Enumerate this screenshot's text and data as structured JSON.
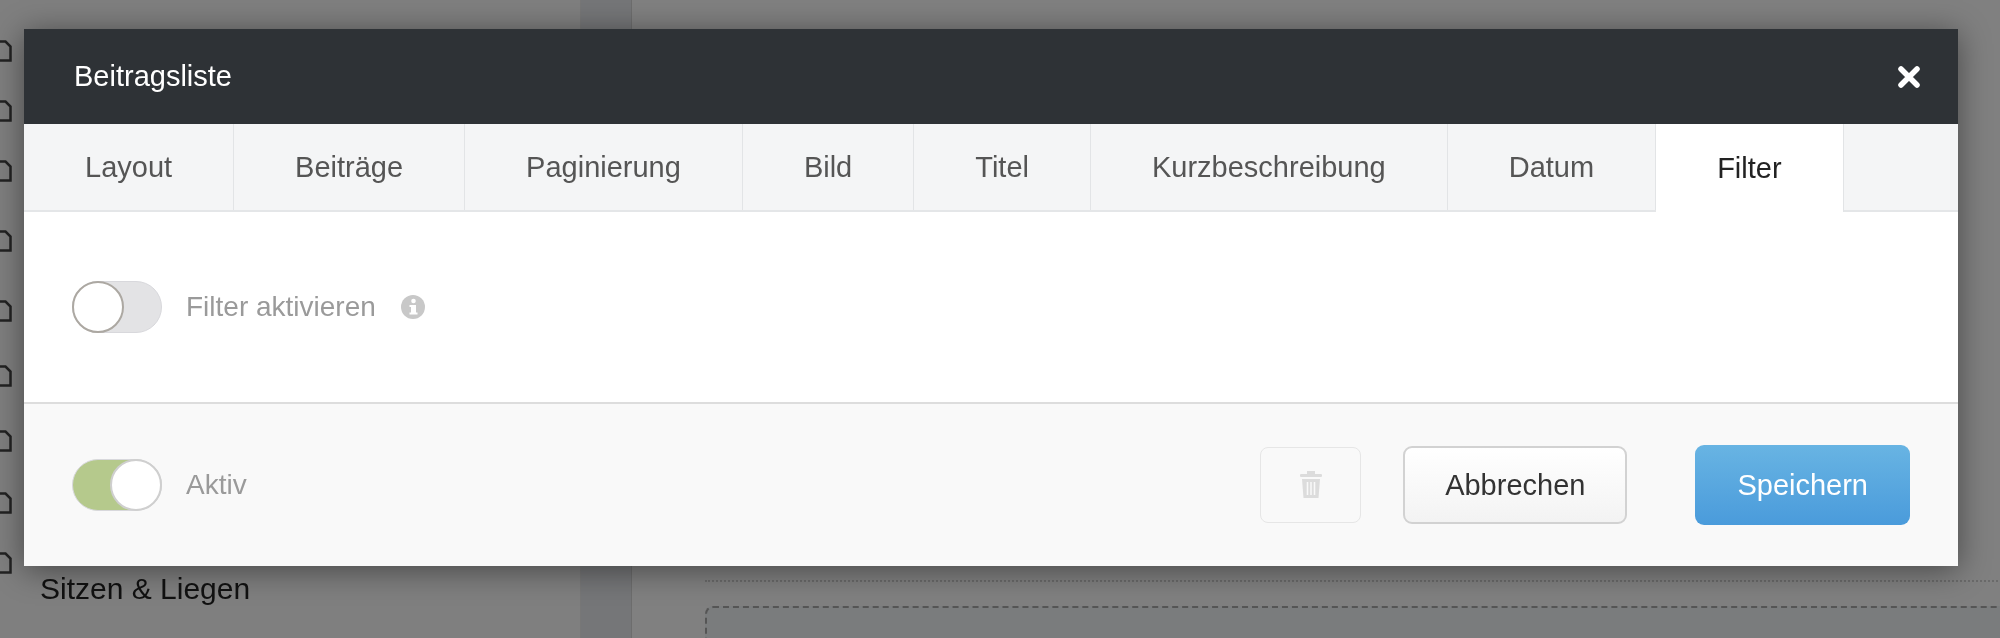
{
  "background": {
    "sidebar_item": "Sitzen & Liegen"
  },
  "window": {
    "title": "Beitragsliste"
  },
  "tabs": [
    {
      "label": "Layout",
      "selected": false
    },
    {
      "label": "Beiträge",
      "selected": false
    },
    {
      "label": "Paginierung",
      "selected": false
    },
    {
      "label": "Bild",
      "selected": false
    },
    {
      "label": "Titel",
      "selected": false
    },
    {
      "label": "Kurzbeschreibung",
      "selected": false
    },
    {
      "label": "Datum",
      "selected": false
    },
    {
      "label": "Filter",
      "selected": true
    }
  ],
  "filter_toggle": {
    "label": "Filter aktivieren",
    "on": false
  },
  "active_toggle": {
    "label": "Aktiv",
    "on": true
  },
  "delete_button": {
    "disabled": true
  },
  "buttons": [
    {
      "label": "Abbrechen",
      "kind": "secondary"
    },
    {
      "label": "Speichern",
      "kind": "primary"
    }
  ]
}
